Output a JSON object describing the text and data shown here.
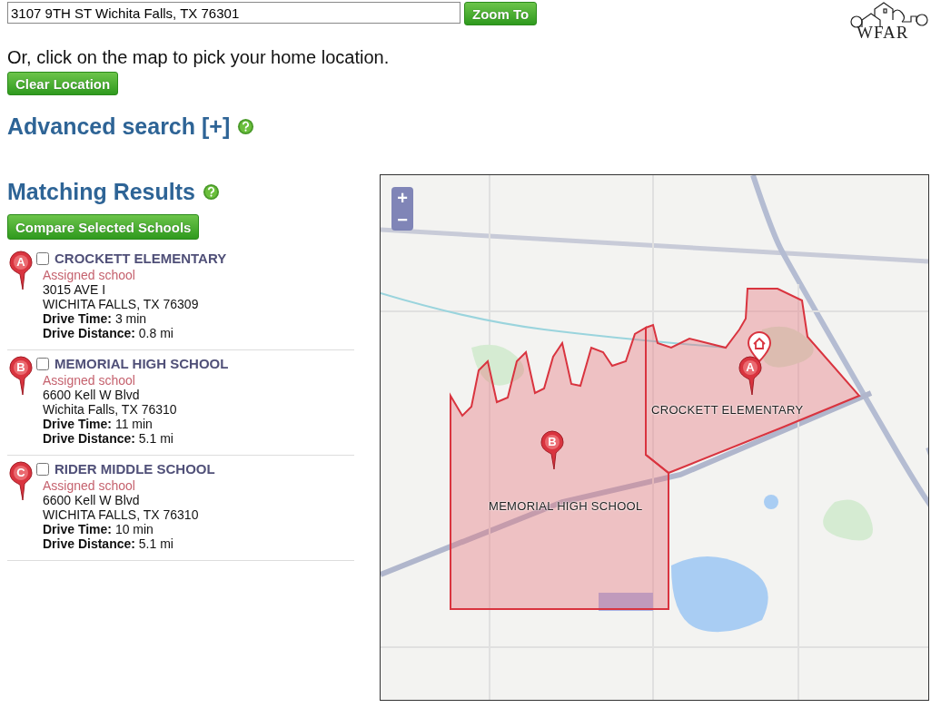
{
  "address_search": {
    "value": "3107 9TH ST Wichita Falls, TX 76301",
    "button": "Zoom To"
  },
  "logo": {
    "text": "WFAR"
  },
  "instruction": "Or, click on the map to pick your home location.",
  "clear_button": "Clear Location",
  "advanced_search": {
    "title": "Advanced search [+]"
  },
  "results": {
    "title": "Matching Results",
    "compare_button": "Compare Selected Schools",
    "schools": [
      {
        "marker": "A",
        "name": "CROCKETT ELEMENTARY",
        "checked": false,
        "status": "Assigned school",
        "address_line_1": "3015 AVE I",
        "address_line_2": "WICHITA FALLS, TX 76309",
        "drive_time": "**Drive Time:**  3 min",
        "drive_distance": "**Drive Distance:**  0.8 mi"
      },
      {
        "marker": "B",
        "name": "MEMORIAL HIGH SCHOOL",
        "checked": false,
        "status": "Assigned school",
        "address_line_1": "6600 Kell W Blvd",
        "address_line_2": "Wichita Falls, TX 76310",
        "drive_time": "**Drive Time:**  11 min",
        "drive_distance": "**Drive Distance:**  5.1 mi"
      },
      {
        "marker": "C",
        "name": "RIDER MIDDLE SCHOOL",
        "checked": false,
        "status": "Assigned school",
        "address_line_1": "6600 Kell W Blvd",
        "address_line_2": "WICHITA FALLS, TX 76310",
        "drive_time": "**Drive Time:**  10 min",
        "drive_distance": "**Drive Distance:**  5.1 mi"
      }
    ]
  },
  "map": {
    "zoom_in": "+",
    "zoom_out": "−",
    "districts": [
      {
        "label": "CROCKETT ELEMENTARY",
        "marker": "A"
      },
      {
        "label": "MEMORIAL HIGH SCHOOL",
        "marker": "B"
      }
    ]
  }
}
